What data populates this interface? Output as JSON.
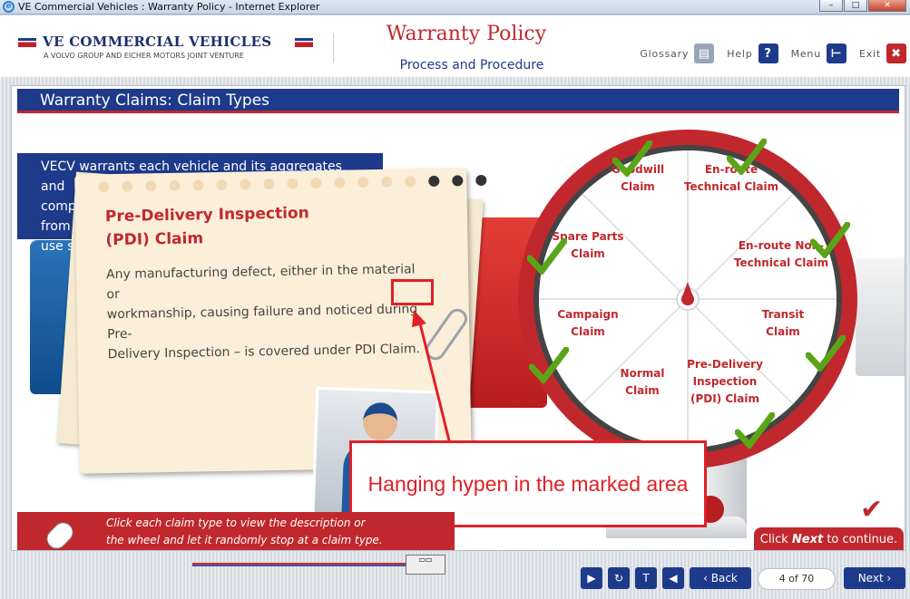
{
  "window": {
    "title": "VE Commercial Vehicles : Warranty Policy - Internet Explorer",
    "buttons": {
      "minimize": "–",
      "maximize": "□",
      "close": "✕"
    }
  },
  "header": {
    "logo_title": "VE COMMERCIAL VEHICLES",
    "logo_subtitle": "A VOLVO GROUP AND EICHER MOTORS JOINT VENTURE",
    "title": "Warranty Policy",
    "subtitle": "Process and Procedure",
    "tools": {
      "glossary": "Glossary",
      "help": "Help",
      "menu": "Menu",
      "exit": "Exit",
      "help_icon": "?",
      "exit_icon": "✖"
    }
  },
  "section": {
    "title": "Warranty Claims: Claim Types"
  },
  "intro": {
    "lines": [
      "VECV wa",
      "comp",
      "from",
      "use su"
    ],
    "line1_tail": "rrants each vehicle and its aggregates and"
  },
  "card": {
    "title_line1": "Pre-Delivery Inspection",
    "title_line2": "(PDI) Claim",
    "body_1": "Any manufacturing defect, either in the material or",
    "body_2": "workmanship, causing failure and noticed during",
    "body_marked": "Pre-",
    "body_3": "Delivery Inspection – is covered under PDI Claim."
  },
  "callout": {
    "text": "Hanging hypen in the marked area"
  },
  "wheel": {
    "segments": [
      {
        "line1": "Goodwill",
        "line2": "Claim",
        "line3": ""
      },
      {
        "line1": "En-route",
        "line2": "Technical Claim",
        "line3": ""
      },
      {
        "line1": "En-route Non-",
        "line2": "Technical Claim",
        "line3": ""
      },
      {
        "line1": "Transit",
        "line2": "Claim",
        "line3": ""
      },
      {
        "line1": "Pre-Delivery",
        "line2": "Inspection",
        "line3": "(PDI) Claim"
      },
      {
        "line1": "Normal",
        "line2": "Claim",
        "line3": ""
      },
      {
        "line1": "Campaign",
        "line2": "Claim",
        "line3": ""
      },
      {
        "line1": "Spare Parts",
        "line2": "Claim",
        "line3": ""
      }
    ],
    "colors": {
      "rim": "#c0282e",
      "face": "#ffffff",
      "check": "#5aa517"
    }
  },
  "instructions": {
    "line1": "Click each claim type to view the description or",
    "line2": "the wheel and let it randomly stop at a claim type."
  },
  "continue": {
    "prefix": "Click ",
    "emph": "Next",
    "suffix": " to continue."
  },
  "nav": {
    "play_icon": "▶",
    "replay_icon": "↻",
    "text_icon": "T",
    "audio_icon": "◀",
    "back": "‹ Back",
    "page": "4 of 70",
    "next": "Next ›"
  },
  "colors": {
    "brand_blue": "#1e3a8a",
    "brand_red": "#c0282e",
    "annotation_red": "#e02027"
  }
}
